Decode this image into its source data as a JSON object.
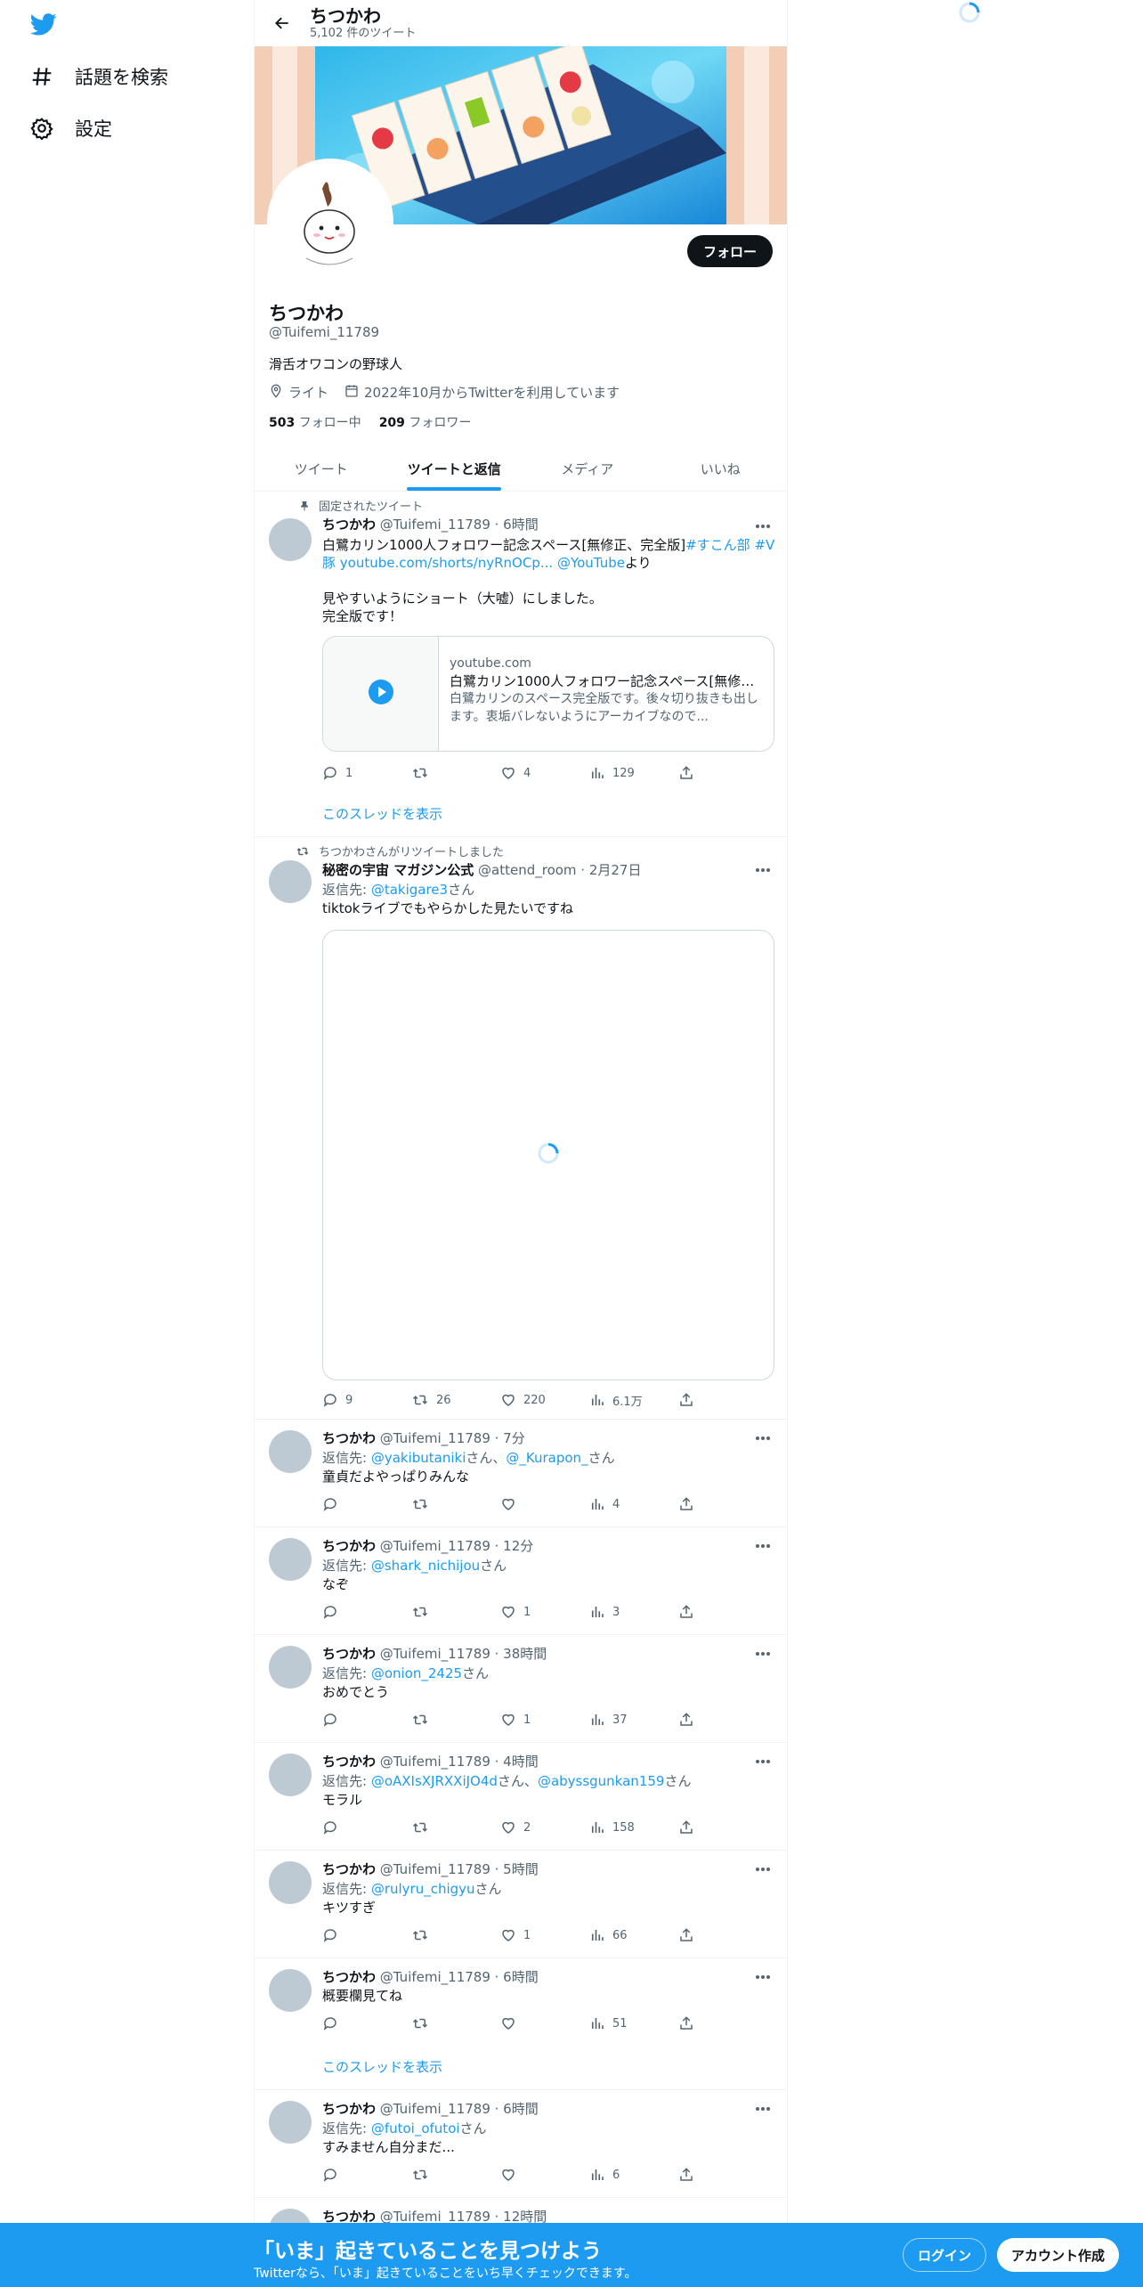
{
  "nav": {
    "logo": "twitter-bird-icon",
    "explore_label": "話題を検索",
    "settings_label": "設定"
  },
  "header": {
    "title": "ちつかわ",
    "tweet_count": "5,102 件のツイート"
  },
  "profile": {
    "follow_label": "フォロー",
    "name": "ちつかわ",
    "handle": "@Tuifemi_11789",
    "bio": "滑舌オワコンの野球人",
    "location": "ライト",
    "joined": "2022年10月からTwitterを利用しています",
    "following_count": "503",
    "following_label": "フォロー中",
    "followers_count": "209",
    "followers_label": "フォロワー"
  },
  "tabs": [
    "ツイート",
    "ツイートと返信",
    "メディア",
    "いいね"
  ],
  "active_tab": "ツイートと返信",
  "tweets": [
    {
      "context": "固定されたツイート",
      "name": "ちつかわ",
      "meta": "@Tuifemi_11789 · 6時間",
      "text_pre": "白鷺カリン1000人フォロワー記念スペース[無修正、完全版]",
      "hashtag1": "#すこん部",
      "hashtag2": "#V",
      "text_line2_link": "豚 youtube.com/shorts/nyRnOCp...",
      "mention": "@YouTube",
      "text_line2_suffix": "より",
      "text_rest": "見やすいようにショート（大嘘）にしました。\n完全版です！",
      "card": {
        "domain": "youtube.com",
        "title": "白鷺カリン1000人フォロワー記念スペース[無修正...",
        "description": "白鷺カリンのスペース完全版です。後々切り抜きも出します。衷垢バレないようにアーカイブなので..."
      },
      "replies": "1",
      "retweets": "",
      "likes": "4",
      "views": "129",
      "show_thread": "このスレッドを表示"
    },
    {
      "context": "ちつかわさんがリツイートしました",
      "name": "秘密の宇宙 マガジン公式",
      "meta": "@attend_room · 2月27日",
      "reply_prefix": "返信先: ",
      "reply_to": "@takigare3",
      "reply_suffix": "さん",
      "text": "tiktokライブでもやらかした見たいですね",
      "replies": "9",
      "retweets": "26",
      "likes": "220",
      "views": "6.1万"
    },
    {
      "name": "ちつかわ",
      "meta": "@Tuifemi_11789 · 7分",
      "reply_prefix": "返信先: ",
      "reply_to": "@yakibutaniki",
      "reply_mid": "さん、",
      "reply_to2": "@_Kurapon_",
      "reply_suffix": "さん",
      "text": "童貞だよやっぱりみんな",
      "replies": "",
      "retweets": "",
      "likes": "",
      "views": "4"
    },
    {
      "name": "ちつかわ",
      "meta": "@Tuifemi_11789 · 12分",
      "reply_prefix": "返信先: ",
      "reply_to": "@shark_nichijou",
      "reply_suffix": "さん",
      "text": "なぞ",
      "replies": "",
      "retweets": "",
      "likes": "1",
      "views": "3"
    },
    {
      "name": "ちつかわ",
      "meta": "@Tuifemi_11789 · 38時間",
      "reply_prefix": "返信先: ",
      "reply_to": "@onion_2425",
      "reply_suffix": "さん",
      "text": "おめでとう",
      "replies": "",
      "retweets": "",
      "likes": "1",
      "views": "37"
    },
    {
      "name": "ちつかわ",
      "meta": "@Tuifemi_11789 · 4時間",
      "reply_prefix": "返信先: ",
      "reply_to": "@oAXIsXJRXXiJO4d",
      "reply_mid": "さん、",
      "reply_to2": "@abyssgunkan159",
      "reply_suffix": "さん",
      "text": "モラル",
      "replies": "",
      "retweets": "",
      "likes": "2",
      "views": "158"
    },
    {
      "name": "ちつかわ",
      "meta": "@Tuifemi_11789 · 5時間",
      "reply_prefix": "返信先: ",
      "reply_to": "@rulyru_chigyu",
      "reply_suffix": "さん",
      "text": "キツすぎ",
      "replies": "",
      "retweets": "",
      "likes": "1",
      "views": "66"
    },
    {
      "name": "ちつかわ",
      "meta": "@Tuifemi_11789 · 6時間",
      "text": "概要欄見てね",
      "replies": "",
      "retweets": "",
      "likes": "",
      "views": "51",
      "show_thread": "このスレッドを表示"
    },
    {
      "name": "ちつかわ",
      "meta": "@Tuifemi_11789 · 6時間",
      "reply_prefix": "返信先: ",
      "reply_to": "@futoi_ofutoi",
      "reply_suffix": "さん",
      "text": "すみません自分まだ...",
      "replies": "",
      "retweets": "",
      "likes": "",
      "views": "6"
    },
    {
      "name": "ちつかわ",
      "meta": "@Tuifemi_11789 · 12時間"
    }
  ],
  "bottom_bar": {
    "title": "「いま」起きていることを見つけよう",
    "subtitle": "Twitterなら、「いま」起きていることをいち早くチェックできます。",
    "login_label": "ログイン",
    "signup_label": "アカウント作成"
  },
  "colors": {
    "accent": "#1d9bf0",
    "text_primary": "#0f1419",
    "text_secondary": "#536471"
  }
}
